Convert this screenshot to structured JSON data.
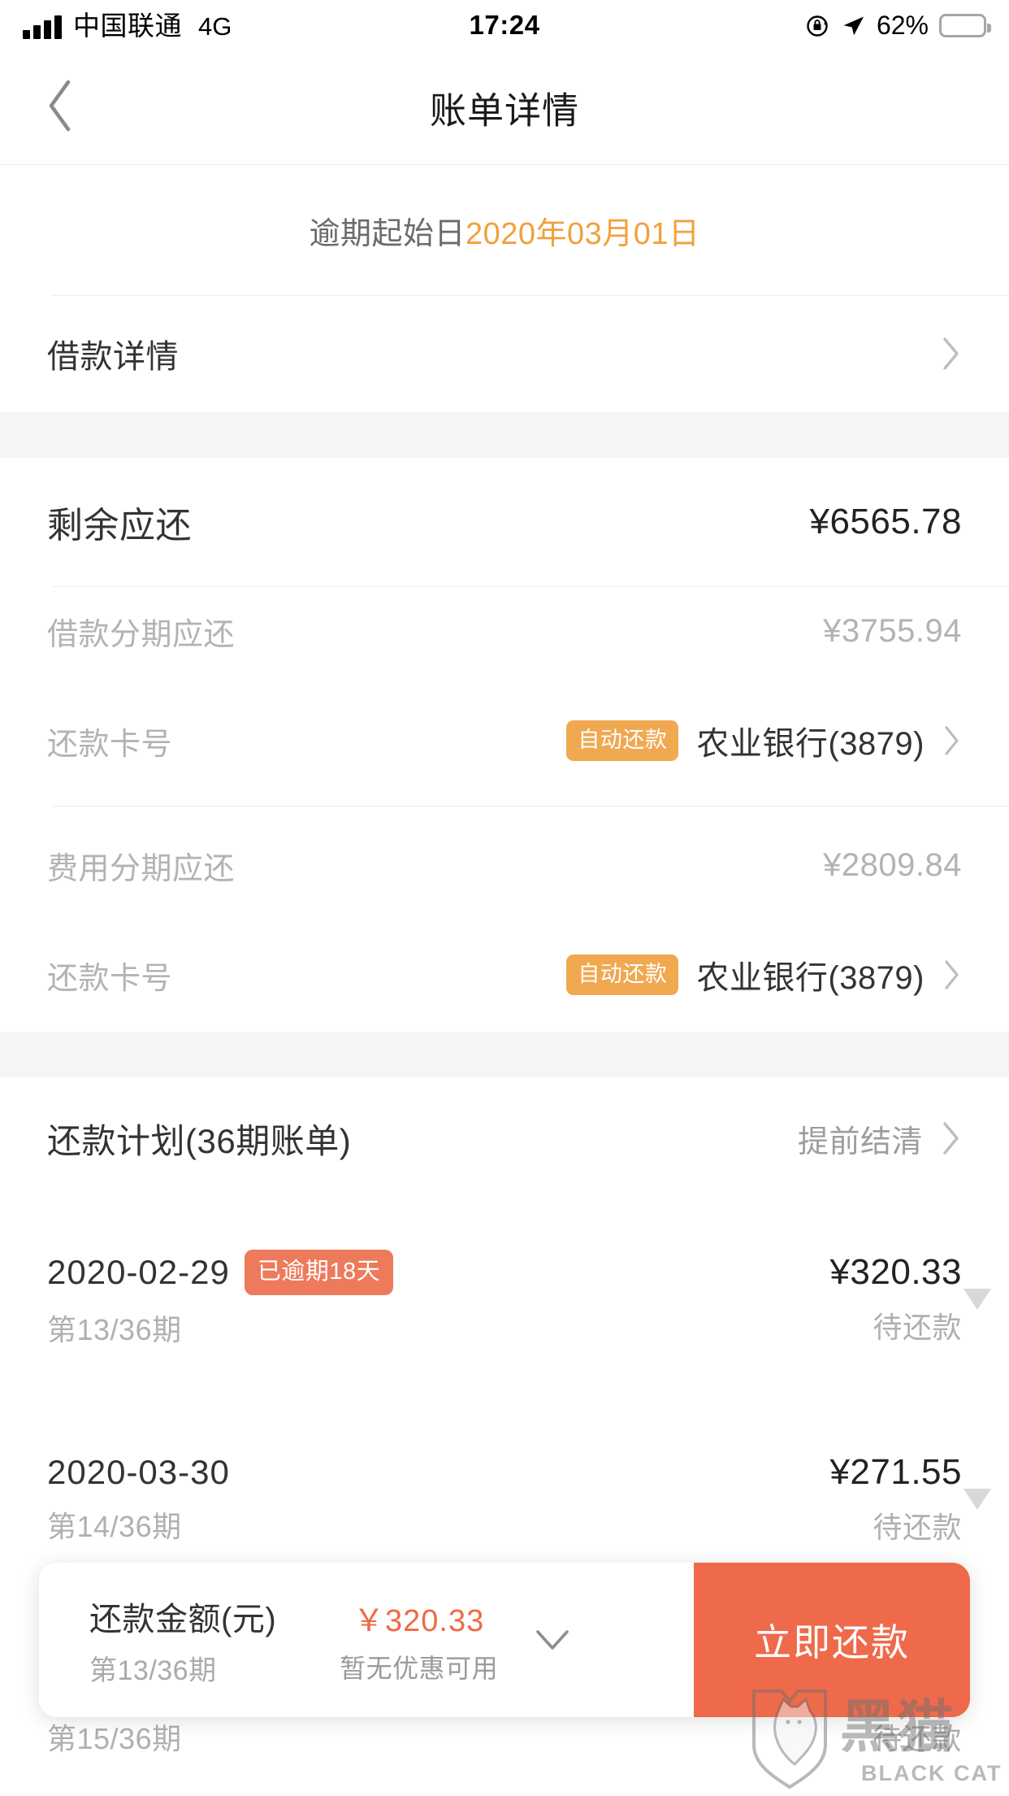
{
  "status_bar": {
    "carrier": "中国联通",
    "network": "4G",
    "time": "17:24",
    "battery_percent": "62%",
    "battery_level": 62,
    "icons": [
      "signal-bars-icon",
      "rotation-lock-icon",
      "location-arrow-icon",
      "battery-icon"
    ]
  },
  "nav": {
    "title": "账单详情",
    "back_icon": "chevron-left-icon"
  },
  "overdue_banner": {
    "label": "逾期起始日",
    "date": "2020年03月01日",
    "date_color": "#f0a13c"
  },
  "loan_detail": {
    "label": "借款详情",
    "chevron": "chevron-right-icon"
  },
  "summary": {
    "remaining_label": "剩余应还",
    "remaining_value": "¥6565.78",
    "groups": [
      {
        "amount_label": "借款分期应还",
        "amount_value": "¥3755.94",
        "card_label": "还款卡号",
        "auto_badge": "自动还款",
        "bank": "农业银行(3879)"
      },
      {
        "amount_label": "费用分期应还",
        "amount_value": "¥2809.84",
        "card_label": "还款卡号",
        "auto_badge": "自动还款",
        "bank": "农业银行(3879)"
      }
    ]
  },
  "plan": {
    "title": "还款计划(36期账单)",
    "settle_early": "提前结清",
    "installments": [
      {
        "date": "2020-02-29",
        "overdue_badge": "已逾期18天",
        "term": "第13/36期",
        "amount": "¥320.33",
        "status": "待还款"
      },
      {
        "date": "2020-03-30",
        "overdue_badge": "",
        "term": "第14/36期",
        "amount": "¥271.55",
        "status": "待还款"
      },
      {
        "date": "",
        "overdue_badge": "",
        "term": "第15/36期",
        "amount": "",
        "status": "待还款"
      }
    ]
  },
  "pay_bar": {
    "amount_title": "还款金额(元)",
    "term": "第13/36期",
    "price": "￥320.33",
    "promo": "暂无优惠可用",
    "expand_icon": "chevron-down-icon",
    "button_label": "立即还款",
    "button_color": "#ee6a4b"
  },
  "watermark": {
    "cn": "黑猫",
    "en": "BLACK CAT"
  },
  "colors": {
    "accent_orange": "#f0a851",
    "overdue_red": "#ee7a5c",
    "section_bg": "#f5f5f7"
  }
}
